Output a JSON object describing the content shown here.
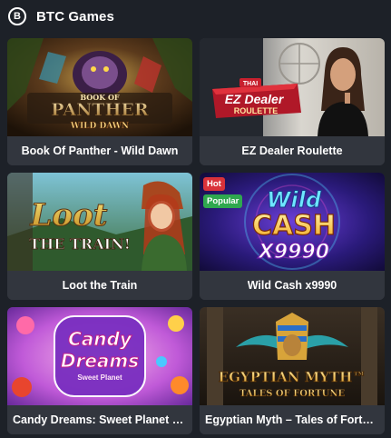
{
  "header": {
    "icon": "bitcoin-icon",
    "icon_glyph": "B",
    "title": "BTC Games"
  },
  "games": [
    {
      "name": "Book Of Panther - Wild Dawn",
      "art_lines": [
        "BOOK OF",
        "PANTHER",
        "WILD DAWN"
      ],
      "badges": []
    },
    {
      "name": "EZ Dealer Roulette",
      "art_lines": [
        "THAI",
        "EZ Dealer",
        "ROULETTE"
      ],
      "badges": []
    },
    {
      "name": "Loot the Train",
      "art_lines": [
        "Loot",
        "THE TRAIN!"
      ],
      "badges": []
    },
    {
      "name": "Wild Cash x9990",
      "art_lines": [
        "Wild",
        "CASH",
        "X9990"
      ],
      "badges": [
        "Hot",
        "Popular"
      ]
    },
    {
      "name": "Candy Dreams: Sweet Planet Bo...",
      "art_lines": [
        "Candy",
        "Dreams",
        "Sweet Planet"
      ],
      "badges": []
    },
    {
      "name": "Egyptian Myth – Tales of Fortune",
      "art_lines": [
        "EGYPTIAN MYTH™",
        "TALES OF FORTUNE"
      ],
      "badges": []
    }
  ]
}
